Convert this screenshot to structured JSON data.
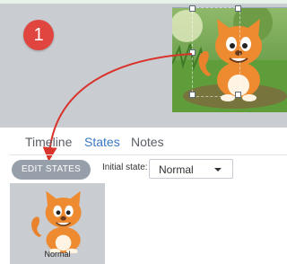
{
  "marker": {
    "number": "1",
    "color": "#e0463f"
  },
  "tabs": [
    {
      "label": "Timeline",
      "active": false
    },
    {
      "label": "States",
      "active": true
    },
    {
      "label": "Notes",
      "active": false
    }
  ],
  "states_toolbar": {
    "edit_button_label": "EDIT STATES",
    "initial_state_label": "Initial state:",
    "initial_state_value": "Normal",
    "dropdown_icon": "chevron-down-icon"
  },
  "state_list": [
    {
      "label": "Normal",
      "icon": "cat-character"
    }
  ],
  "colors": {
    "accent_tab": "#3a78c6",
    "arrow": "#d9342b",
    "button": "#97a0aa"
  }
}
